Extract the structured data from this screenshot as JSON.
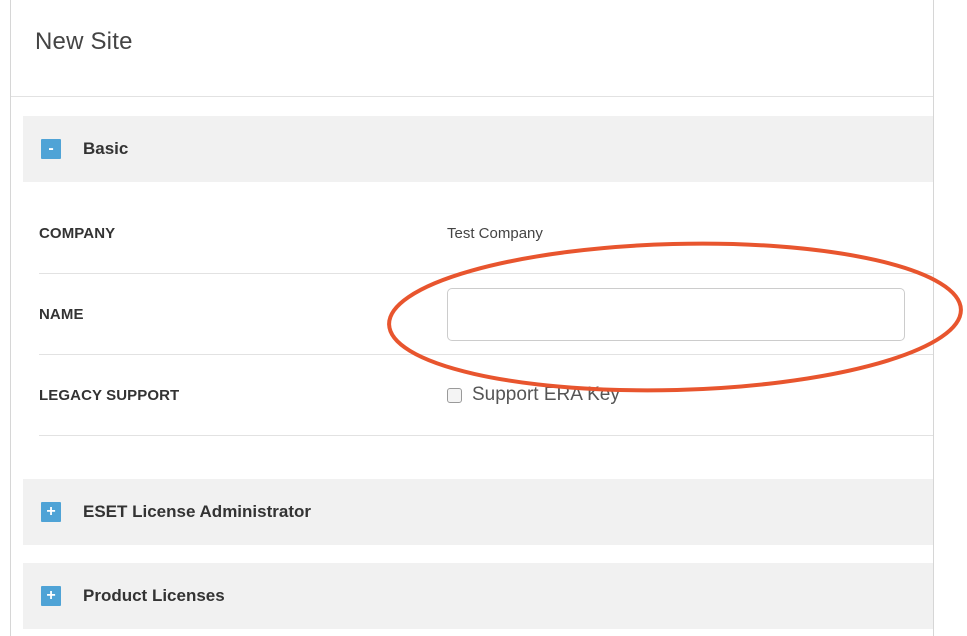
{
  "page": {
    "title": "New Site"
  },
  "sections": {
    "basic": {
      "label": "Basic",
      "toggle": "-"
    },
    "eset_license_admin": {
      "label": "ESET License Administrator",
      "toggle": "+"
    },
    "product_licenses": {
      "label": "Product Licenses",
      "toggle": "+"
    }
  },
  "fields": {
    "company": {
      "label": "COMPANY",
      "value": "Test Company"
    },
    "name": {
      "label": "NAME",
      "value": "",
      "placeholder": ""
    },
    "legacy_support": {
      "label": "LEGACY SUPPORT",
      "checkbox_label": "Support ERA Key",
      "checked": false
    }
  },
  "annotation": {
    "color": "#e8552e",
    "shape": "ellipse-highlight"
  }
}
